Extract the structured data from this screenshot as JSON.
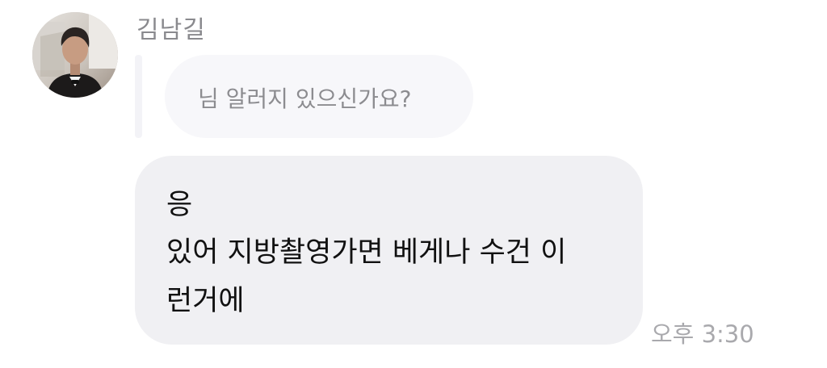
{
  "sender": {
    "name": "김남길"
  },
  "reply": {
    "quoted_text": "님 알러지 있으신가요?"
  },
  "message": {
    "lines": [
      "응",
      "있어 지방촬영가면 베게나 수건 이",
      "런거에"
    ],
    "time": "오후 3:30"
  },
  "colors": {
    "bubble": "#f0f0f3",
    "reply_bubble": "#f7f7fa",
    "name_text": "#8a8a8e",
    "time_text": "#a9a9ad"
  }
}
